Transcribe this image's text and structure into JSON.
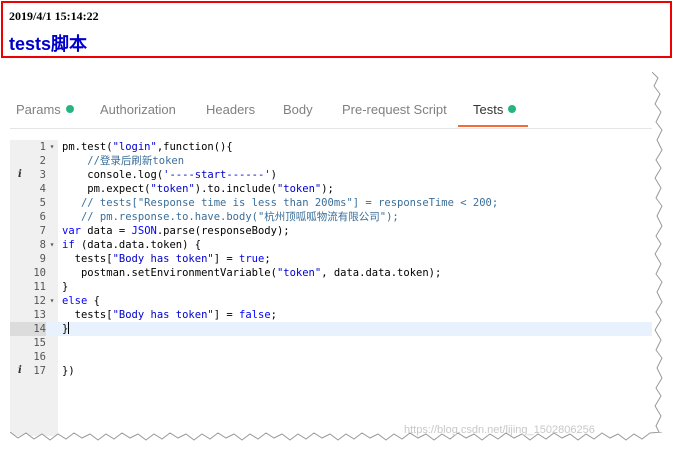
{
  "header": {
    "date": "2019/4/1 15:14:22",
    "title": "tests脚本"
  },
  "tabs": [
    {
      "label": "Params",
      "has_dot": true,
      "active": false
    },
    {
      "label": "Authorization",
      "has_dot": false,
      "active": false
    },
    {
      "label": "Headers",
      "has_dot": false,
      "active": false
    },
    {
      "label": "Body",
      "has_dot": false,
      "active": false
    },
    {
      "label": "Pre-request Script",
      "has_dot": false,
      "active": false
    },
    {
      "label": "Tests",
      "has_dot": true,
      "active": true
    }
  ],
  "colors": {
    "header_border": "#ee0000",
    "title_color": "#0000cc",
    "active_tab_underline": "#f26b3a",
    "dot_color": "#26b47f"
  },
  "editor": {
    "active_line": 14,
    "lines": [
      {
        "num": "1",
        "fold": true,
        "info": false
      },
      {
        "num": "2",
        "fold": false,
        "info": false
      },
      {
        "num": "3",
        "fold": false,
        "info": true
      },
      {
        "num": "4",
        "fold": false,
        "info": false
      },
      {
        "num": "5",
        "fold": false,
        "info": false
      },
      {
        "num": "6",
        "fold": false,
        "info": false
      },
      {
        "num": "7",
        "fold": false,
        "info": false
      },
      {
        "num": "8",
        "fold": true,
        "info": false
      },
      {
        "num": "9",
        "fold": false,
        "info": false
      },
      {
        "num": "10",
        "fold": false,
        "info": false
      },
      {
        "num": "11",
        "fold": false,
        "info": false
      },
      {
        "num": "12",
        "fold": true,
        "info": false
      },
      {
        "num": "13",
        "fold": false,
        "info": false
      },
      {
        "num": "14",
        "fold": false,
        "info": false
      },
      {
        "num": "15",
        "fold": false,
        "info": false
      },
      {
        "num": "16",
        "fold": false,
        "info": false
      },
      {
        "num": "17",
        "fold": false,
        "info": true
      }
    ],
    "code": {
      "l1a": "pm.test(",
      "l1b": "\"login\"",
      "l1c": ",function(){",
      "l2": "    //登录后刷新token",
      "l3a": "    console.log(",
      "l3b": "'----start------'",
      "l3c": ")",
      "l4a": "    pm.expect(",
      "l4b": "\"token\"",
      "l4c": ").to.include(",
      "l4d": "\"token\"",
      "l4e": ");",
      "l5": "   // tests[\"Response time is less than 200ms\"] = responseTime < 200;",
      "l6": "   // pm.response.to.have.body(\"杭州顶呱呱物流有限公司\");",
      "l7a": "var",
      "l7b": " data = ",
      "l7c": "JSON",
      "l7d": ".parse(responseBody);",
      "l8a": "if",
      "l8b": " (data.data.token) {",
      "l9a": "  tests[",
      "l9b": "\"Body has token\"",
      "l9c": "] = ",
      "l9d": "true",
      "l9e": ";",
      "l10a": "   postman.setEnvironmentVariable(",
      "l10b": "\"token\"",
      "l10c": ", data.data.token);",
      "l11": "}",
      "l12a": "else",
      "l12b": " {",
      "l13a": "  tests[",
      "l13b": "\"Body has token\"",
      "l13c": "] = ",
      "l13d": "false",
      "l13e": ";",
      "l14": "}",
      "l15": "",
      "l16": "",
      "l17": "})"
    }
  },
  "watermark": "https://blog.csdn.net/lijing_1502806256"
}
